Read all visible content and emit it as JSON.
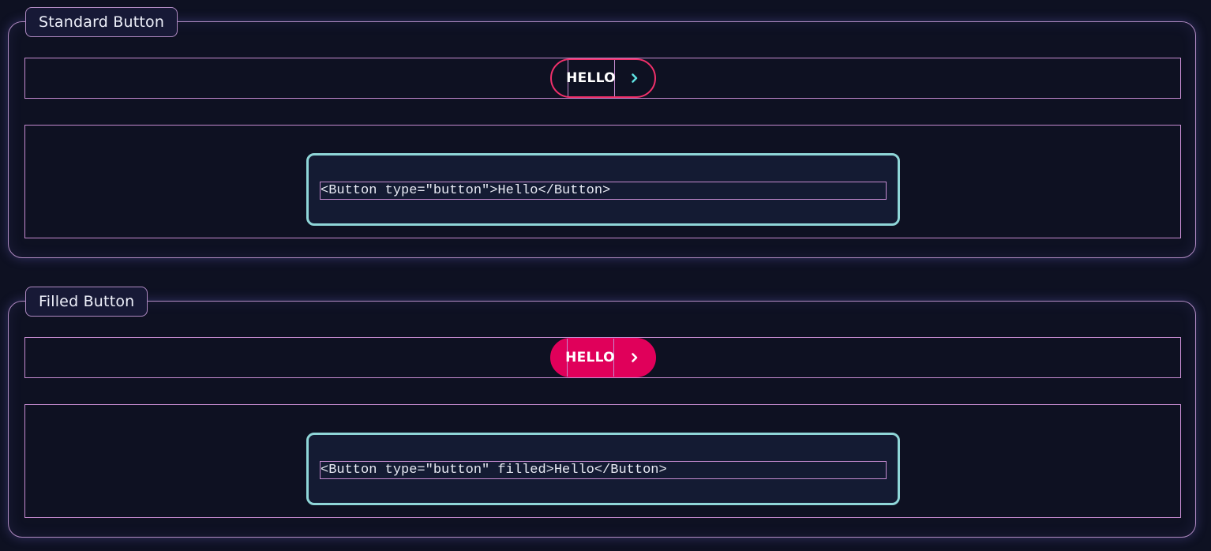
{
  "sections": [
    {
      "legend": "Standard Button",
      "button": {
        "label": "HELLO",
        "variant": "standard",
        "border_color": "#f0306b",
        "chevron_color": "#5ee0e0"
      },
      "code": "<Button type=\"button\">Hello</Button>"
    },
    {
      "legend": "Filled Button",
      "button": {
        "label": "HELLO",
        "variant": "filled",
        "fill_color": "#e0005a",
        "chevron_color": "#ffffff"
      },
      "code": "<Button type=\"button\" filled>Hello</Button>"
    }
  ],
  "icons": {
    "chevron": "chevron-right-icon"
  },
  "colors": {
    "background": "#0e1122",
    "section_border": "#b08ac2",
    "code_border": "#8fd6d8",
    "accent": "#e0005a"
  }
}
